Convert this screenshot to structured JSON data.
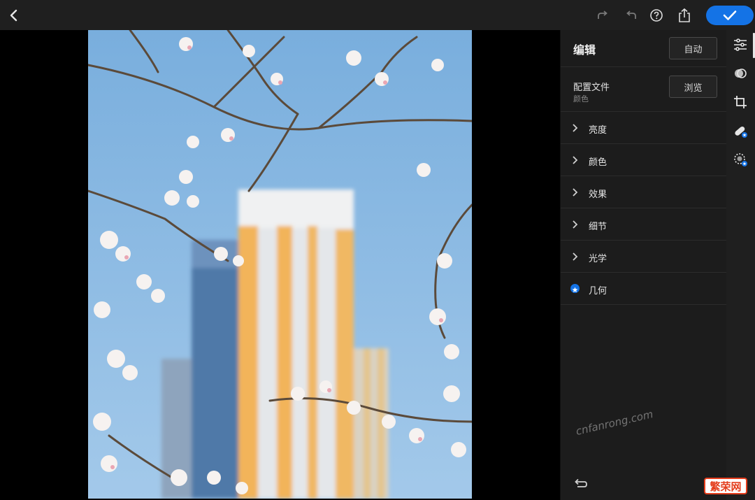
{
  "topbar": {
    "back_icon": "chevron-left-icon",
    "redo_icon": "redo-icon",
    "undo_icon": "undo-icon",
    "help_icon": "help-circle-icon",
    "share_icon": "share-icon",
    "confirm_icon": "checkmark-icon",
    "confirm_color": "#1473e6"
  },
  "panel": {
    "title": "编辑",
    "auto_button": "自动",
    "profile": {
      "label": "配置文件",
      "sub": "颜色",
      "browse_button": "浏览"
    },
    "sections": [
      {
        "label": "亮度",
        "icon": "chevron-right-icon"
      },
      {
        "label": "颜色",
        "icon": "chevron-right-icon"
      },
      {
        "label": "效果",
        "icon": "chevron-right-icon"
      },
      {
        "label": "细节",
        "icon": "chevron-right-icon"
      },
      {
        "label": "光学",
        "icon": "chevron-right-icon"
      },
      {
        "label": "几何",
        "icon": "premium-badge-icon"
      }
    ],
    "reset_icon": "reset-undo-icon"
  },
  "rail": {
    "items": [
      {
        "icon": "sliders-icon",
        "active": true
      },
      {
        "icon": "selective-edit-icon",
        "active": false
      },
      {
        "icon": "crop-icon",
        "active": false
      },
      {
        "icon": "healing-icon",
        "active": false
      },
      {
        "icon": "masking-icon",
        "active": false
      }
    ]
  },
  "photo": {
    "description_icon": "photo-image"
  },
  "watermark": "cnfanrong.com",
  "logo": "繁荣网"
}
